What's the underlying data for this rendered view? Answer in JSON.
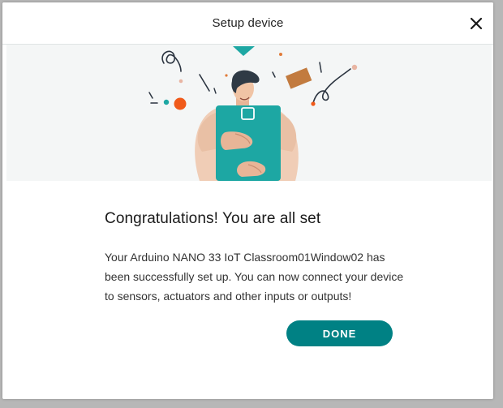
{
  "dialog": {
    "title": "Setup device",
    "close_icon": "close-icon"
  },
  "illustration": {
    "description_icon": "person-holding-board-illustration"
  },
  "content": {
    "heading": "Congratulations! You are all set",
    "message": "Your Arduino NANO 33 IoT Classroom01Window02 has been successfully set up. You can now connect your device to sensors, actuators and other inputs or outputs!"
  },
  "actions": {
    "done_label": "DONE"
  },
  "colors": {
    "accent": "#008184",
    "hero_background": "#f4f6f6",
    "overlay": "#b7b7b7"
  }
}
